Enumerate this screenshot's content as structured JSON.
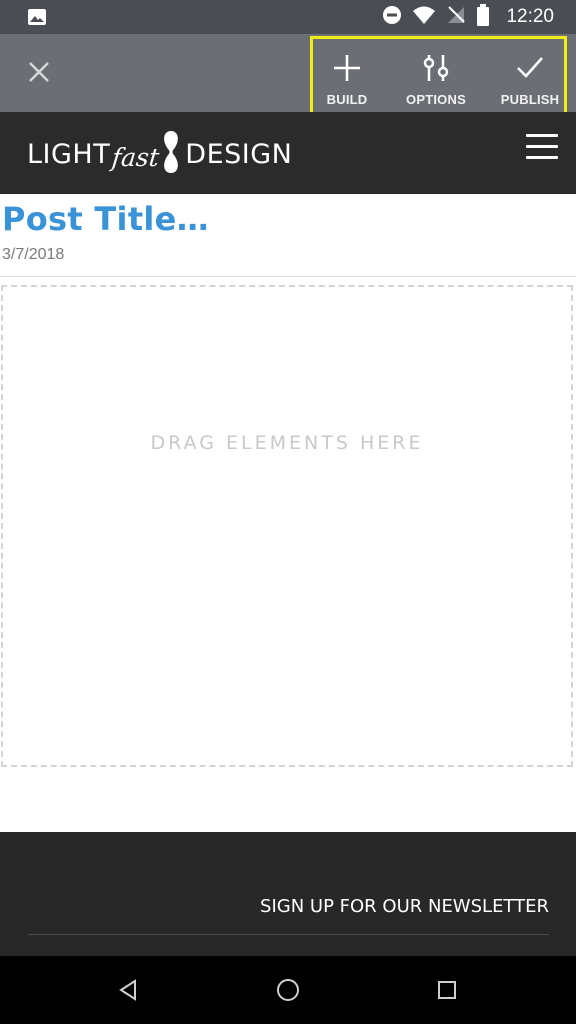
{
  "status_bar": {
    "time": "12:20",
    "icons": [
      "image-icon",
      "do-not-disturb-icon",
      "wifi-icon",
      "no-signal-icon",
      "battery-icon"
    ]
  },
  "toolbar": {
    "close_icon": "close-icon",
    "actions": [
      {
        "label": "BUILD",
        "icon": "plus-icon"
      },
      {
        "label": "OPTIONS",
        "icon": "sliders-icon"
      },
      {
        "label": "PUBLISH",
        "icon": "check-icon"
      }
    ],
    "highlight_color": "#f3ec19"
  },
  "site_header": {
    "logo": {
      "part1": "LIGHT",
      "part2": "fast",
      "part3": "DESIGN"
    },
    "menu_icon": "hamburger-menu-icon"
  },
  "post": {
    "title": "Post Title…",
    "date": "3/7/2018",
    "title_color": "#3a93d6"
  },
  "dropzone": {
    "text": "DRAG ELEMENTS HERE"
  },
  "footer": {
    "newsletter": "SIGN UP FOR OUR NEWSLETTER"
  },
  "nav_bar": {
    "icons": [
      "back-icon",
      "home-icon",
      "recents-icon"
    ]
  }
}
